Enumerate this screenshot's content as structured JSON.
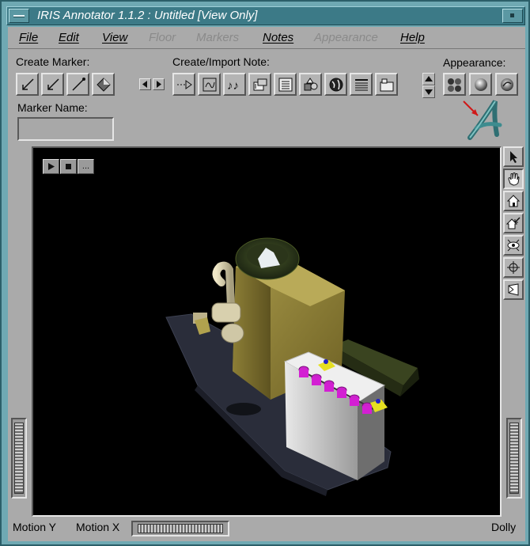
{
  "window": {
    "title": "IRIS Annotator 1.1.2 : Untitled [View Only]"
  },
  "menubar": {
    "items": [
      {
        "label": "File",
        "enabled": true
      },
      {
        "label": "Edit",
        "enabled": true
      },
      {
        "label": "View",
        "enabled": true
      },
      {
        "label": "Floor",
        "enabled": false
      },
      {
        "label": "Markers",
        "enabled": false
      },
      {
        "label": "Notes",
        "enabled": true
      },
      {
        "label": "Appearance",
        "enabled": false
      },
      {
        "label": "Help",
        "enabled": true
      }
    ]
  },
  "toolbar": {
    "create_marker_label": "Create Marker:",
    "create_note_label": "Create/Import Note:",
    "appearance_label": "Appearance:",
    "marker_name_label": "Marker Name:",
    "marker_name_value": "",
    "marker_buttons": [
      "arrow-marker-icon",
      "bent-arrow-marker-icon",
      "line-marker-icon",
      "diamond-marker-icon"
    ],
    "note_buttons": [
      "text-note-icon",
      "scribble-note-icon",
      "music-note-icon",
      "film-note-icon",
      "document-note-icon",
      "shapes-note-icon",
      "globe-note-icon",
      "list-note-icon",
      "folder-note-icon"
    ],
    "appearance_buttons": [
      "spheres-icon",
      "shaded-sphere-icon",
      "swirl-sphere-icon"
    ]
  },
  "viewer": {
    "background": "#000000",
    "controls": [
      "play-icon",
      "stop-icon",
      "more-icon"
    ],
    "more_label": "...",
    "side_tools": [
      "pointer-icon",
      "hand-icon",
      "home-icon",
      "set-home-icon",
      "view-all-icon",
      "seek-icon",
      "perspective-icon"
    ]
  },
  "status": {
    "motion_y": "Motion Y",
    "motion_x": "Motion X",
    "dolly": "Dolly"
  },
  "colors": {
    "window_frame": "#6fa9b3",
    "titlebar": "#3c7a87",
    "panel": "#aaaaaa"
  }
}
